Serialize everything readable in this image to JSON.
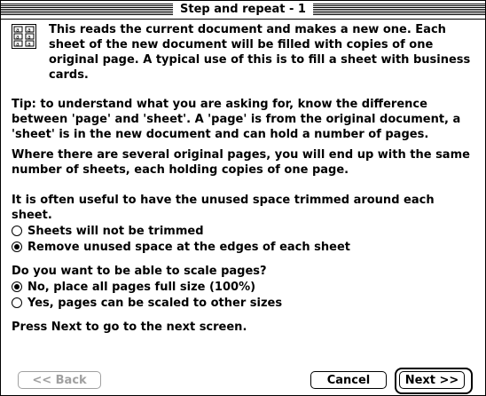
{
  "window": {
    "title": "Step and repeat - 1"
  },
  "intro": "This reads the current document and makes a new one. Each sheet of the new document will be filled with copies of one original page. A typical use of this is to fill a sheet with business cards.",
  "tip": "Tip: to understand what you are asking for, know the difference between 'page' and 'sheet'. A 'page' is from the original document, a 'sheet' is in the new document and can hold a number of pages.",
  "several": "Where there are several original pages, you will end up with the same number of sheets, each holding copies of one page.",
  "trim": {
    "question": "It is often useful to have the unused space trimmed around each sheet.",
    "options": [
      {
        "label": "Sheets will not be trimmed",
        "selected": false
      },
      {
        "label": "Remove unused space at the edges of each sheet",
        "selected": true
      }
    ]
  },
  "scale": {
    "question": "Do you want to be able to scale pages?",
    "options": [
      {
        "label": "No, place all pages full size (100%)",
        "selected": true
      },
      {
        "label": "Yes, pages can be scaled to other sizes",
        "selected": false
      }
    ]
  },
  "footer_note": "Press Next to go to the next screen.",
  "buttons": {
    "back": "<< Back",
    "cancel": "Cancel",
    "next": "Next >>"
  },
  "icon": "step-repeat-grid-icon"
}
